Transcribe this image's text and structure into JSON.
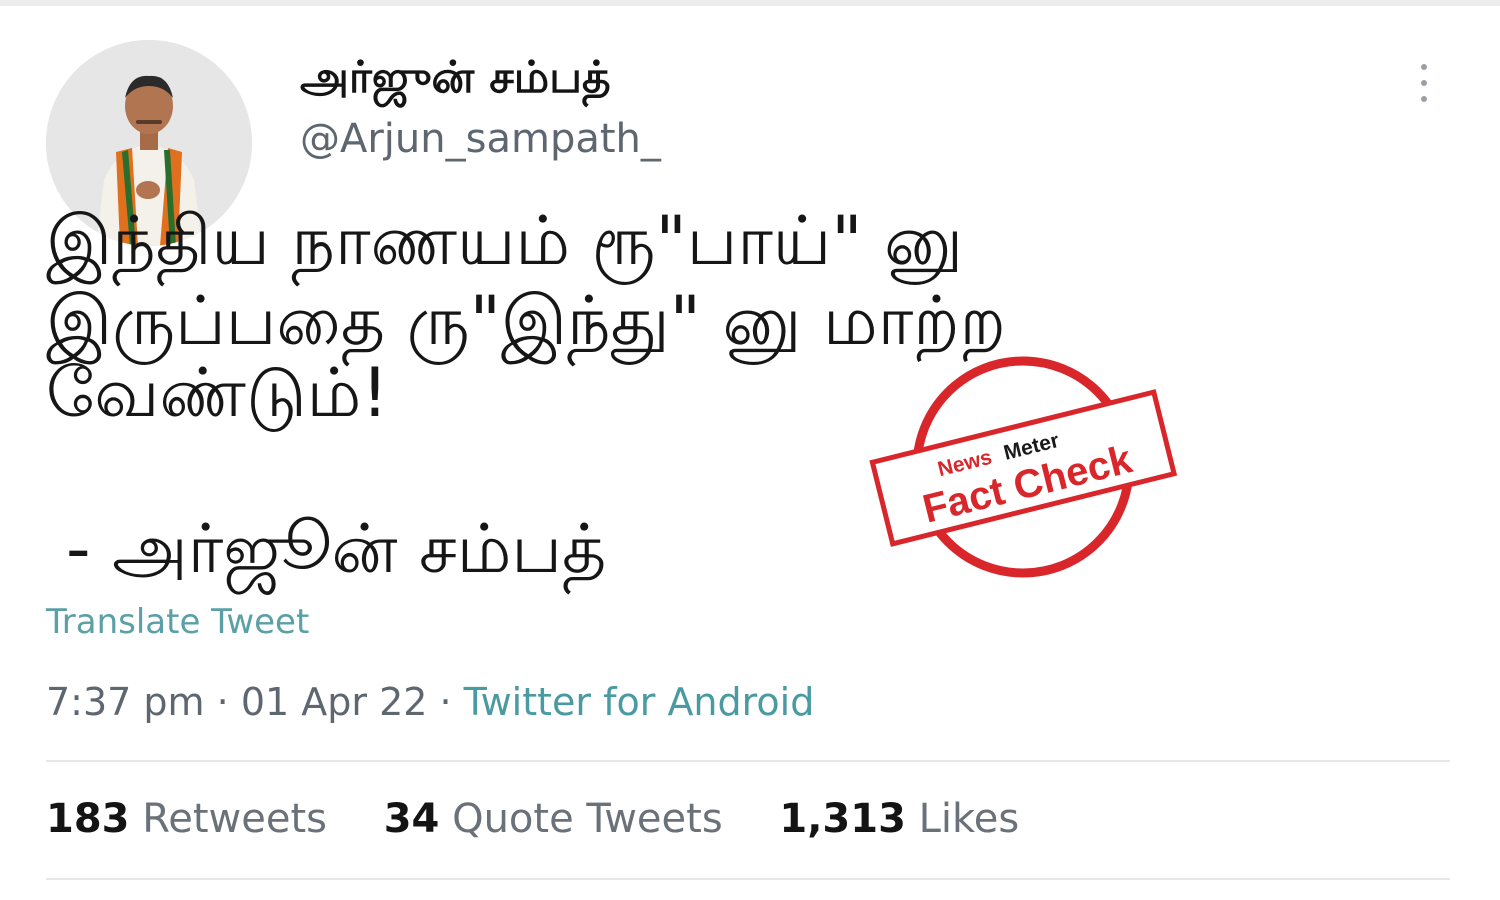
{
  "tweet": {
    "display_name": "அர்ஜுன் சம்பத்",
    "handle": "@Arjun_sampath_",
    "more_icon": "more-vertical-icon",
    "text_lines": [
      "இந்திய நாணயம்  ரூ\"பாய்\" னு",
      "இருப்பதை ரு\"இந்து\" னு மாற்ற",
      "வேண்டும்!",
      "- அர்ஜூன் சம்பத்"
    ],
    "translate_label": "Translate Tweet",
    "time": "7:37 pm",
    "date": "01 Apr 22",
    "separator": " · ",
    "source": "Twitter for Android",
    "stats": {
      "retweets_count": "183",
      "retweets_label": "Retweets",
      "quotes_count": "34",
      "quotes_label": "Quote Tweets",
      "likes_count": "1,313",
      "likes_label": "Likes"
    }
  },
  "stamp": {
    "brand_prefix": "News",
    "brand_suffix": "Meter",
    "label": "Fact Check",
    "color": "#d8262b"
  },
  "colors": {
    "link": "#4a9aa2",
    "muted": "#5e6670"
  }
}
